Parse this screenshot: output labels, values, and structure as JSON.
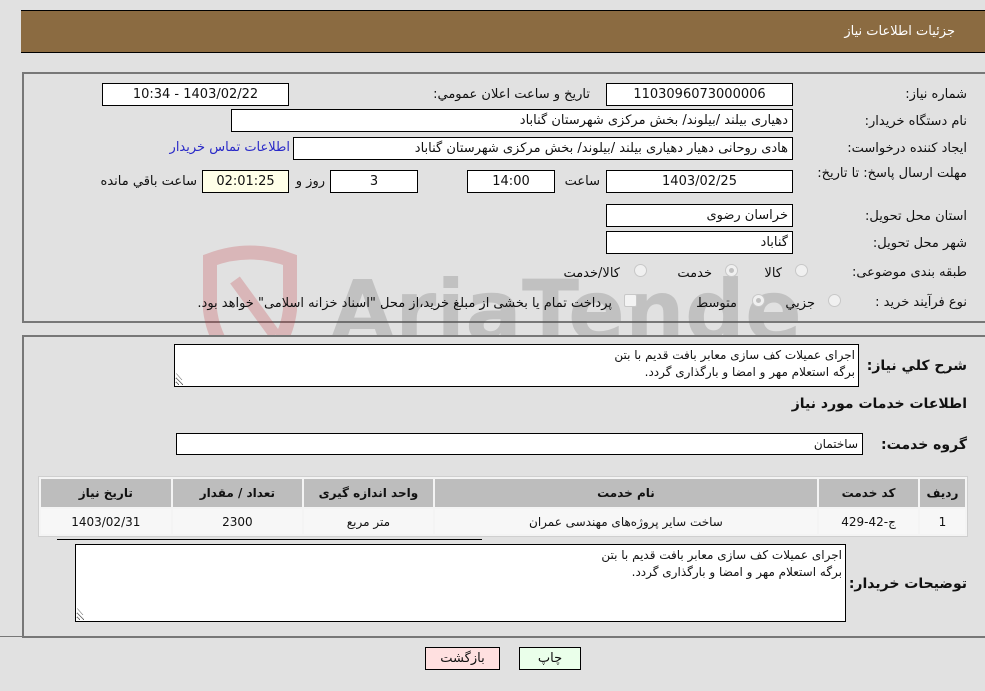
{
  "header": {
    "title": "جزئیات اطلاعات نیاز"
  },
  "form": {
    "need_number": {
      "label": "شماره نیاز:",
      "value": "1103096073000006"
    },
    "announce_datetime": {
      "label": "تاریخ و ساعت اعلان عمومي:",
      "value": "1403/02/22 - 10:34"
    },
    "buyer_org": {
      "label": "نام دستگاه خریدار:",
      "value": "دهیاری بیلند /بیلوند/ بخش مرکزی شهرستان گناباد"
    },
    "requester": {
      "label": "ایجاد کننده درخواست:",
      "value": "هادی روحانی دهیار دهیاری بیلند /بیلوند/ بخش مرکزی شهرستان گناباد"
    },
    "buyer_contact_link": "اطلاعات تماس خریدار",
    "deadline": {
      "label": "مهلت ارسال پاسخ: تا تاریخ:",
      "date": "1403/02/25",
      "time_label": "ساعت",
      "time": "14:00",
      "days": "3",
      "days_label": "روز و",
      "remaining": "02:01:25",
      "remaining_label": "ساعت باقي مانده"
    },
    "delivery_province": {
      "label": "استان محل تحویل:",
      "value": "خراسان رضوی"
    },
    "delivery_city": {
      "label": "شهر محل تحویل:",
      "value": "گناباد"
    },
    "category": {
      "label": "طبقه بندی موضوعی:",
      "options": [
        "کالا",
        "خدمت",
        "کالا/خدمت"
      ],
      "selected": "خدمت"
    },
    "purchase_type": {
      "label": "نوع فرآیند خرید :",
      "options": [
        "جزيي",
        "متوسط"
      ],
      "selected": "متوسط",
      "treasury_note": "پرداخت تمام یا بخشی از مبلغ خرید،از محل \"اسناد خزانه اسلامی\" خواهد بود."
    }
  },
  "details": {
    "general_desc_label": "شرح کلي نياز:",
    "general_desc_value": "اجرای عمیلات کف سازی معابر بافت قدیم با بتن\nبرگه استعلام مهر و امضا و بارگذاری گردد.",
    "services_heading": "اطلاعات خدمات مورد نیاز",
    "service_group_label": "گروه خدمت:",
    "service_group_value": "ساختمان",
    "table": {
      "headers": [
        "ردیف",
        "کد خدمت",
        "نام خدمت",
        "واحد اندازه گیری",
        "تعداد / مقدار",
        "تاریخ نیاز"
      ],
      "rows": [
        [
          "1",
          "ج-42-429",
          "ساخت سایر پروژه‌های مهندسی عمران",
          "متر مربع",
          "2300",
          "1403/02/31"
        ]
      ]
    },
    "buyer_notes_label": "توضیحات خریدار:",
    "buyer_notes_value": "اجرای عمیلات کف سازی معابر بافت قدیم با بتن\nبرگه استعلام مهر و امضا و بارگذاری گردد."
  },
  "buttons": {
    "print": "چاپ",
    "back": "بازگشت"
  },
  "watermark": "AriaTender.neT",
  "colors": {
    "header_bg": "#8b6b41",
    "print_bg": "#eaffea",
    "back_bg": "#ffe0e0",
    "link": "#2a2ac8"
  }
}
